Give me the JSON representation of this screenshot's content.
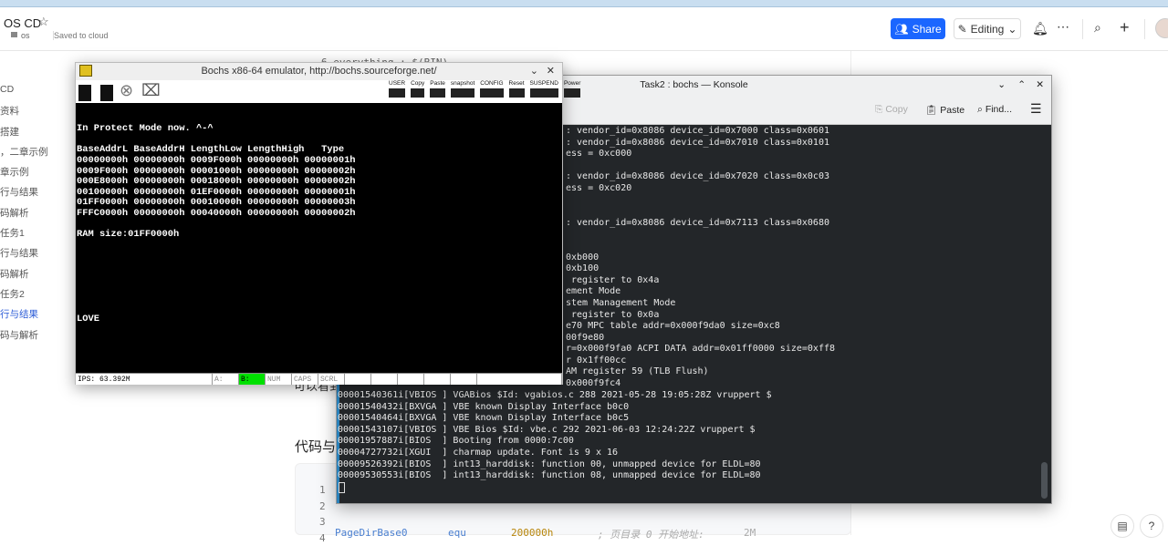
{
  "header": {
    "doc_title": "OS CD",
    "folder": "os",
    "save_status": "Saved to cloud",
    "share_label": "Share",
    "editing_label": "Editing"
  },
  "sidebar": {
    "items": [
      "CD",
      "资料",
      "搭建",
      "，二章示例",
      "章示例",
      "行与结果",
      "码解析",
      "任务1",
      "行与结果",
      "码解析",
      "任务2",
      "行与结果",
      "码与解析"
    ],
    "active_index": 11
  },
  "doc": {
    "code_top": "6  everything : $(BIN)",
    "para_fragment": "可以看到",
    "heading_fragment": "代码与",
    "line_numbers": [
      "1",
      "2",
      "3",
      "4"
    ],
    "code_line4": {
      "label": "PageDirBase0",
      "op": "equ",
      "value": "200000h",
      "comment": "; 页目录 0 开始地址:",
      "size": "2M"
    }
  },
  "bochs": {
    "title": "Bochs x86-64 emulator, http://bochs.sourceforge.net/",
    "toolbar_right": [
      "USER",
      "Copy",
      "Paste",
      "snapshot",
      "CONFIG",
      "Reset",
      "SUSPEND",
      "Power"
    ],
    "toolbar_left": [
      "A:",
      "B:",
      "CD"
    ],
    "screen_lines": [
      "",
      "",
      "In Protect Mode now. ^-^",
      "",
      "BaseAddrL BaseAddrH LengthLow LengthHigh   Type",
      "00000000h 00000000h 0009F000h 00000000h 00000001h",
      "0009F000h 00000000h 00001000h 00000000h 00000002h",
      "000E8000h 00000000h 00018000h 00000000h 00000002h",
      "00100000h 00000000h 01EF0000h 00000000h 00000001h",
      "01FF0000h 00000000h 00010000h 00000000h 00000003h",
      "FFFC0000h 00000000h 00040000h 00000000h 00000002h",
      "",
      "RAM size:01FF0000h",
      "",
      "",
      "",
      "",
      "",
      "",
      "",
      "LOVE"
    ],
    "status": {
      "ips": "IPS: 63.392M",
      "a": "A:",
      "b": "B:",
      "num": "NUM",
      "caps": "CAPS",
      "scrl": "SCRL"
    },
    "b_active_color": "#00e000"
  },
  "konsole": {
    "title": "Task2 : bochs — Konsole",
    "copy_label": "Copy",
    "paste_label": "Paste",
    "find_label": "Find...",
    "partial_lines": [
      ": vendor_id=0x8086 device_id=0x7000 class=0x0601",
      ": vendor_id=0x8086 device_id=0x7010 class=0x0101",
      "ess = 0xc000",
      "",
      ": vendor_id=0x8086 device_id=0x7020 class=0x0c03",
      "ess = 0xc020",
      "",
      "",
      ": vendor_id=0x8086 device_id=0x7113 class=0x0680",
      "",
      "",
      "0xb000",
      "0xb100",
      " register to 0x4a",
      "ement Mode",
      "stem Management Mode",
      " register to 0x0a",
      "e70 MPC table addr=0x000f9da0 size=0xc8",
      "00f9e80",
      "r=0x000f9fa0 ACPI DATA addr=0x01ff0000 size=0xff8",
      "r 0x1ff00cc",
      "AM register 59 (TLB Flush)",
      "0x000f9fc4"
    ],
    "lines": [
      "00001540361i[VBIOS ] VGABios $Id: vgabios.c 288 2021-05-28 19:05:28Z vruppert $",
      "00001540432i[BXVGA ] VBE known Display Interface b0c0",
      "00001540464i[BXVGA ] VBE known Display Interface b0c5",
      "00001543107i[VBIOS ] VBE Bios $Id: vbe.c 292 2021-06-03 12:24:22Z vruppert $",
      "00001957887i[BIOS  ] Booting from 0000:7c00",
      "00004727732i[XGUI  ] charmap update. Font is 9 x 16",
      "00009526392i[BIOS  ] int13_harddisk: function 00, unmapped device for ELDL=80",
      "00009530553i[BIOS  ] int13_harddisk: function 08, unmapped device for ELDL=80"
    ]
  },
  "colors": {
    "accent": "#1a66ff",
    "terminal_bg": "#232629"
  }
}
